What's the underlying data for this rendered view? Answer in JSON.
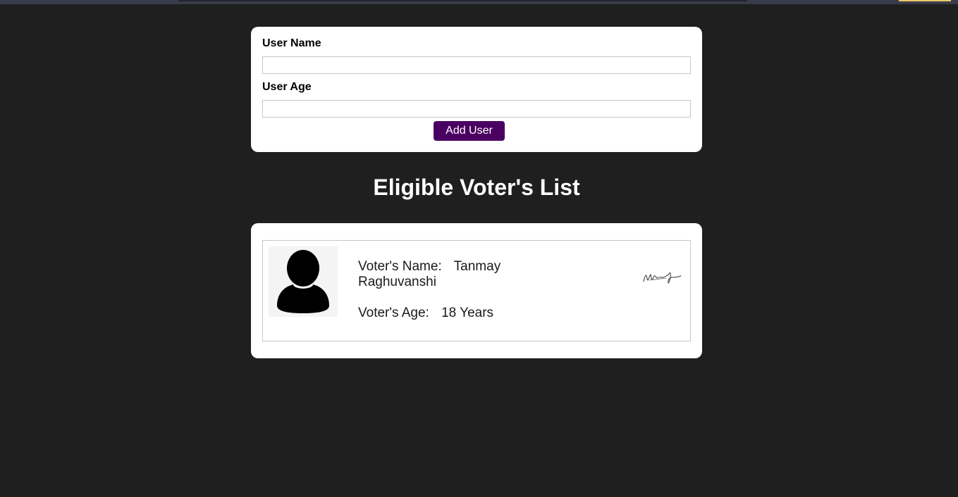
{
  "form": {
    "name_label": "User Name",
    "name_value": "",
    "age_label": "User Age",
    "age_value": "",
    "submit_label": "Add User"
  },
  "list": {
    "title": "Eligible Voter's List",
    "voters": [
      {
        "name_label": "Voter's Name:",
        "name": "Tanmay Raghuvanshi",
        "age_label": "Voter's Age:",
        "age": "18 Years",
        "avatar_icon": "user-avatar-icon",
        "signature_icon": "signature-icon"
      }
    ]
  },
  "colors": {
    "page_background": "#1f1f1f",
    "card_background": "#ffffff",
    "button_background": "#4a0060",
    "button_text": "#ffffff",
    "title_text": "#ffffff"
  }
}
